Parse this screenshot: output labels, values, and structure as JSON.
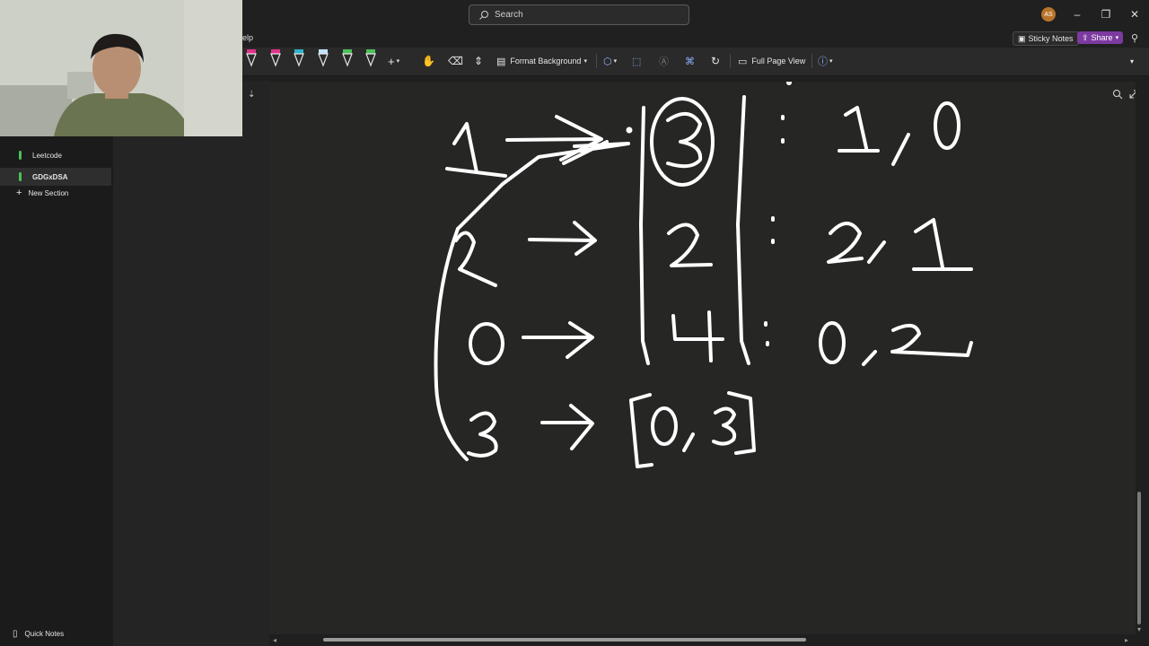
{
  "titlebar": {
    "search_placeholder": "Search",
    "avatar_initials": "AS",
    "minimize_icon": "minimize-icon",
    "restore_icon": "restore-icon",
    "close_icon": "close-icon"
  },
  "menu": {
    "help_label": "elp",
    "sticky_notes_label": "Sticky Notes",
    "share_label": "Share"
  },
  "ribbon": {
    "format_background_label": "Format Background",
    "full_page_view_label": "Full Page View",
    "pen_colors": [
      "#e0338a",
      "#e0338a",
      "#2fb3c9",
      "#bfe3ff",
      "#4cc05a",
      "#4cc05a"
    ]
  },
  "sections": [
    {
      "label": "Leetcode",
      "color": "#4cc05a",
      "active": false
    },
    {
      "label": "GDGxDSA",
      "color": "#4cc05a",
      "active": true
    }
  ],
  "new_section_label": "New Section",
  "quick_notes_label": "Quick Notes",
  "ink_note": {
    "rows": [
      {
        "left": "1",
        "boxed": "3",
        "pair": "1, 0"
      },
      {
        "left": "2",
        "boxed": "2",
        "pair": "2, 1"
      },
      {
        "left": "0",
        "boxed": "4",
        "pair": "0, 2"
      },
      {
        "left": "3",
        "result": "[0, 3]"
      }
    ]
  },
  "colors": {
    "accent_share": "#7c3aa0",
    "section_tab": "#4cc05a",
    "canvas_bg": "#262625",
    "ink": "#ffffff"
  }
}
